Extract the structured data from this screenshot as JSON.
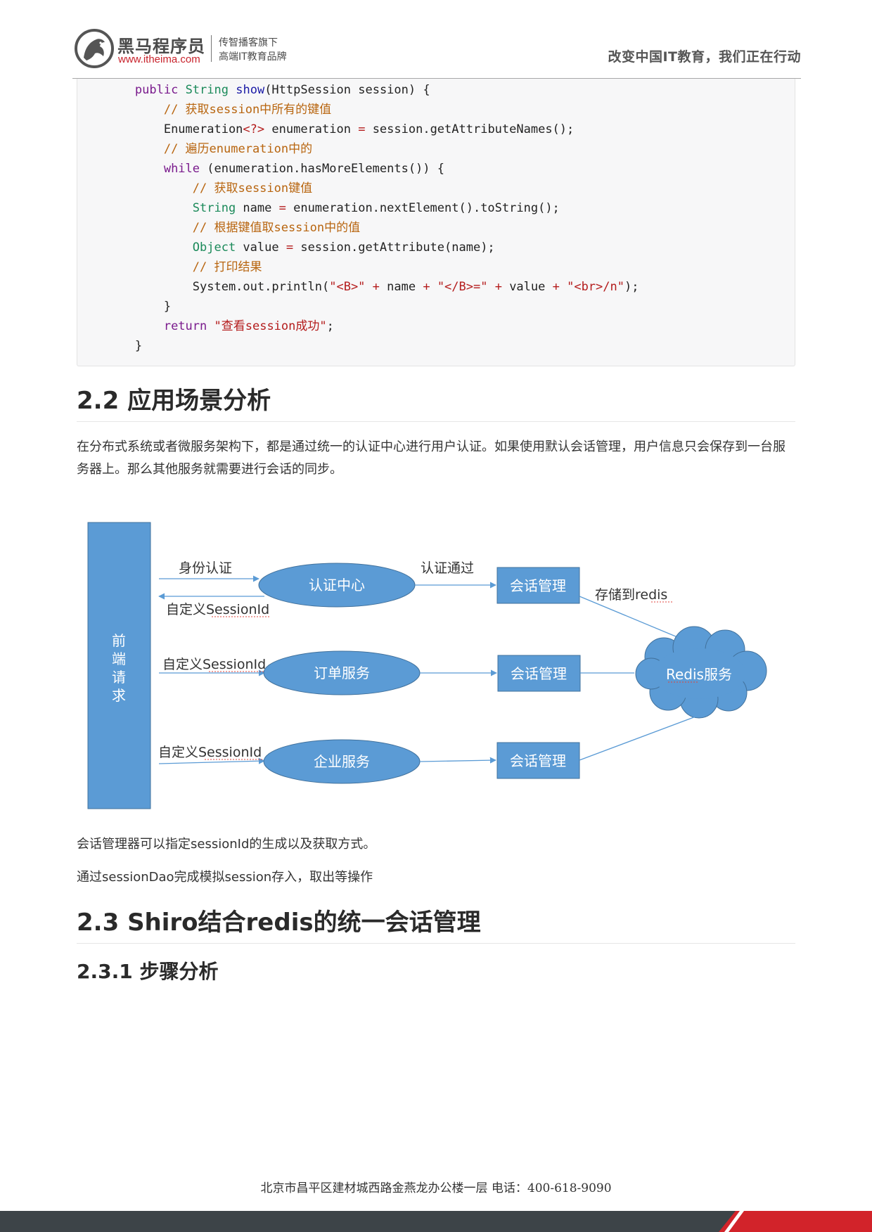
{
  "header": {
    "brand_name": "黑马程序员",
    "brand_url": "www.itheima.com",
    "slogan_line1": "传智播客旗下",
    "slogan_line2": "高端IT教育品牌",
    "motto": "改变中国IT教育，我们正在行动"
  },
  "code": {
    "l1_kw": "public",
    "l1_type": "String",
    "l1_fn": "show",
    "l1_rest": "(HttpSession session) {",
    "l2": "// 获取session中所有的键值",
    "l3_a": "Enumeration",
    "l3_b": "<?>",
    "l3_c": " enumeration ",
    "l3_d": "=",
    "l3_e": " session.getAttributeNames();",
    "l4": "// 遍历enumeration中的",
    "l5_kw": "while",
    "l5_rest": " (enumeration.hasMoreElements()) {",
    "l6": "// 获取session键值",
    "l7_type": "String",
    "l7_a": " name ",
    "l7_op": "=",
    "l7_b": " enumeration.nextElement().toString();",
    "l8": "// 根据键值取session中的值",
    "l9_type": "Object",
    "l9_a": " value ",
    "l9_op": "=",
    "l9_b": " session.getAttribute(name);",
    "l10": "// 打印结果",
    "l11_a": "System.out.println(",
    "l11_s1": "\"<B>\"",
    "l11_op1": " + ",
    "l11_b": "name",
    "l11_op2": " + ",
    "l11_s2": "\"</B>=\"",
    "l11_op3": " + ",
    "l11_c": "value",
    "l11_op4": " + ",
    "l11_s3": "\"<br>/n\"",
    "l11_d": ");",
    "l12": "}",
    "l13_kw": "return",
    "l13_s": "\"查看session成功\"",
    "l13_d": ";",
    "l14": "}"
  },
  "section_22": {
    "title": "2.2 应用场景分析",
    "para": "在分布式系统或者微服务架构下，都是通过统一的认证中心进行用户认证。如果使用默认会话管理，用户信息只会保存到一台服务器上。那么其他服务就需要进行会话的同步。"
  },
  "diagram": {
    "client": [
      "前",
      "端",
      "请",
      "求"
    ],
    "label_identity": "身份认证",
    "label_custom_1": "自定义SessionId",
    "label_custom_2": "自定义SessionId",
    "label_custom_3": "自定义SessionId",
    "label_auth_pass": "认证通过",
    "label_store": "存储到redis",
    "auth_center": "认证中心",
    "order_service": "订单服务",
    "enterprise_service": "企业服务",
    "session_mgr_1": "会话管理",
    "session_mgr_2": "会话管理",
    "session_mgr_3": "会话管理",
    "redis": "Redis服务",
    "fill_color": "#5b9bd5",
    "stroke_color": "#41719c"
  },
  "after_diagram": {
    "para1": "会话管理器可以指定sessionId的生成以及获取方式。",
    "para2": "通过sessionDao完成模拟session存入，取出等操作"
  },
  "section_23": {
    "title": "2.3 Shiro结合redis的统一会话管理",
    "sub_title": "2.3.1 步骤分析"
  },
  "footer": {
    "address": "北京市昌平区建材城西路金燕龙办公楼一层    电话：400-618-9090",
    "bar_color": "#3d4448",
    "accent_color": "#d2232a"
  }
}
